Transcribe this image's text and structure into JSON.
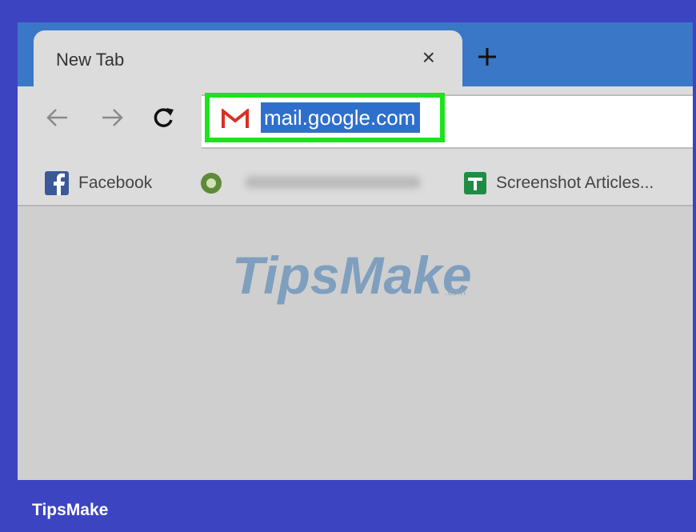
{
  "tab": {
    "title": "New Tab",
    "close_glyph": "×",
    "new_tab_glyph": "+"
  },
  "toolbar": {
    "back_icon": "arrow-left-icon",
    "forward_icon": "arrow-right-icon",
    "reload_icon": "reload-icon",
    "url": "mail.google.com"
  },
  "bookmarks": [
    {
      "label": "Facebook",
      "icon": "facebook-icon"
    },
    {
      "label": "",
      "icon": "green-circle-icon"
    },
    {
      "label": "Screenshot Articles...",
      "icon": "google-sheets-icon"
    }
  ],
  "watermark": {
    "text": "TipsMake",
    "suffix": ".com"
  },
  "footer": {
    "brand": "TipsMake"
  },
  "colors": {
    "frame": "#3d44c2",
    "tabstrip": "#3a77c6",
    "highlight_border": "#1ee21e",
    "url_selection": "#2f6fcc"
  }
}
